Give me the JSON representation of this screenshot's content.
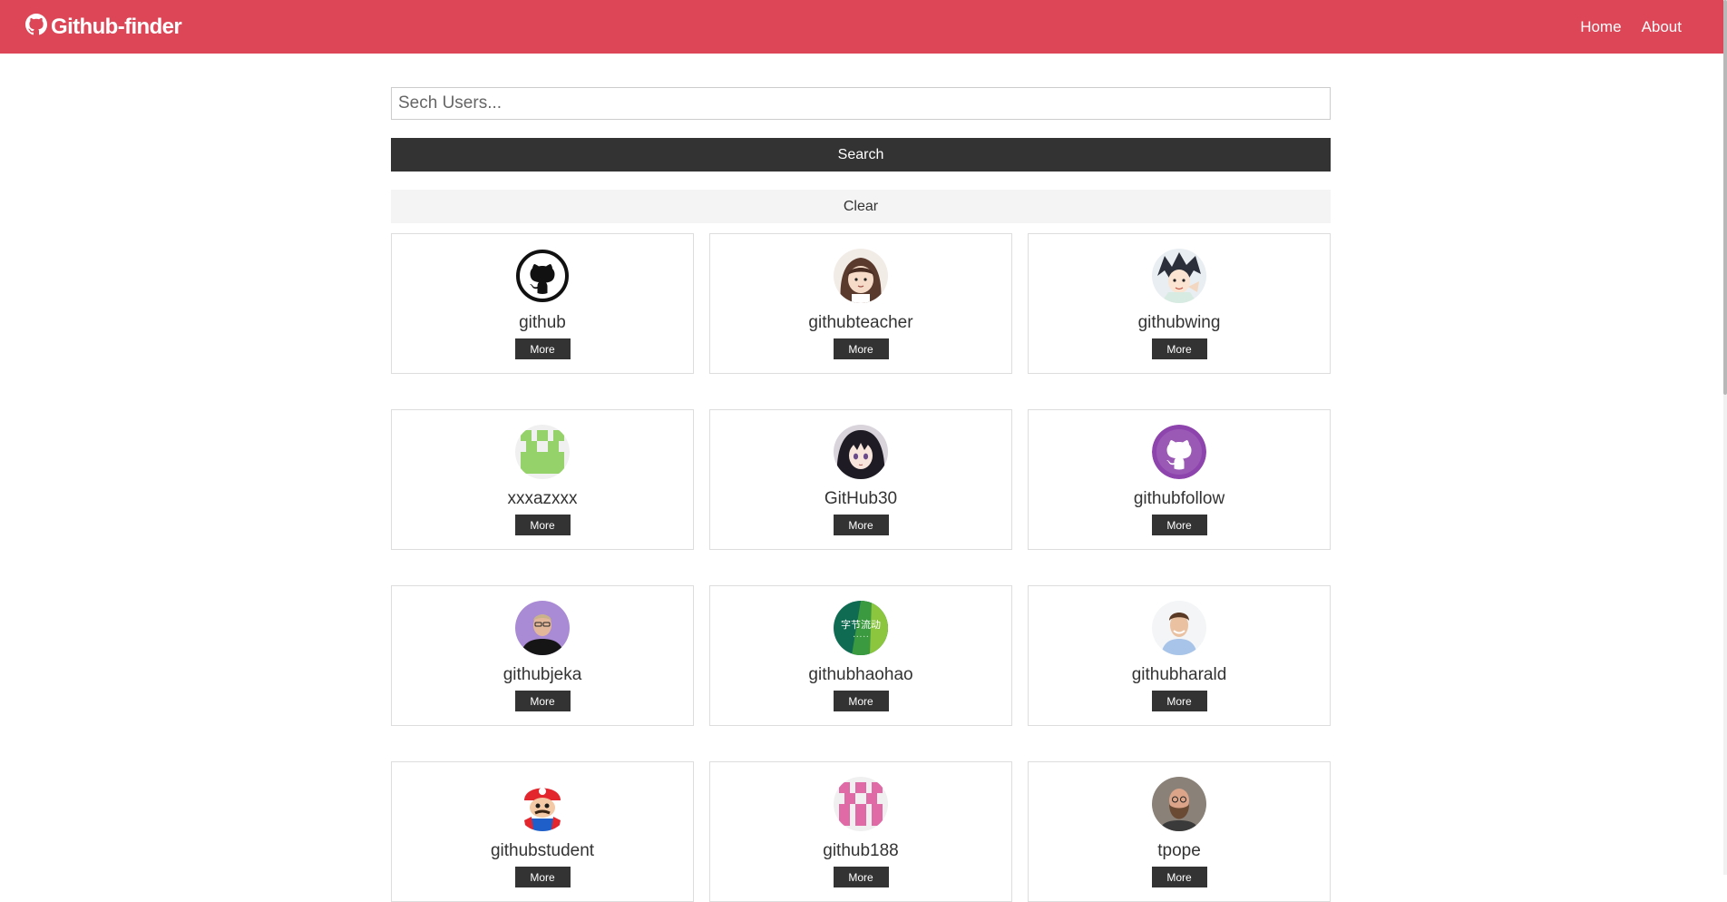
{
  "navbar": {
    "brand": "Github-finder",
    "brand_icon": "github-icon",
    "links": [
      {
        "label": "Home"
      },
      {
        "label": "About"
      }
    ],
    "background": "#dc4656"
  },
  "search": {
    "placeholder": "Sech Users...",
    "value": "",
    "search_label": "Search",
    "clear_label": "Clear"
  },
  "users": [
    {
      "login": "github",
      "more_label": "More",
      "avatar": "github-octocat-black"
    },
    {
      "login": "githubteacher",
      "more_label": "More",
      "avatar": "brown-haired-character"
    },
    {
      "login": "githubwing",
      "more_label": "More",
      "avatar": "anime-boy"
    },
    {
      "login": "xxxazxxx",
      "more_label": "More",
      "avatar": "green-identicon"
    },
    {
      "login": "GitHub30",
      "more_label": "More",
      "avatar": "anime-girl"
    },
    {
      "login": "githubfollow",
      "more_label": "More",
      "avatar": "purple-octocat"
    },
    {
      "login": "githubjeka",
      "more_label": "More",
      "avatar": "man-purple-bg"
    },
    {
      "login": "githubhaohao",
      "more_label": "More",
      "avatar": "green-text-logo"
    },
    {
      "login": "githubharald",
      "more_label": "More",
      "avatar": "smiling-man"
    },
    {
      "login": "githubstudent",
      "more_label": "More",
      "avatar": "mario-octocat"
    },
    {
      "login": "github188",
      "more_label": "More",
      "avatar": "pink-identicon"
    },
    {
      "login": "tpope",
      "more_label": "More",
      "avatar": "bearded-man"
    }
  ],
  "avatar_text": {
    "haohao": "字节流动"
  },
  "colors": {
    "dark_button": "#333333",
    "clear_button": "#f4f4f4"
  }
}
